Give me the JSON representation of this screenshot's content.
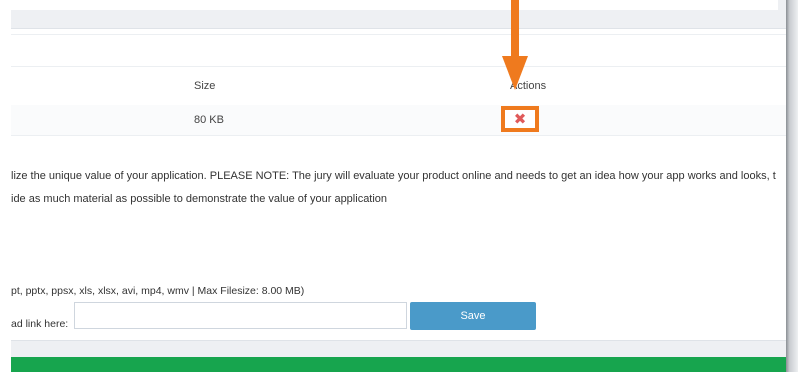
{
  "table": {
    "headers": {
      "size": "Size",
      "actions": "Actions"
    },
    "rows": [
      {
        "size": "80 KB"
      }
    ]
  },
  "description": {
    "line1": "lize the unique value of your application. PLEASE NOTE: The jury will evaluate your product online and needs to get an idea how your app works and looks, t",
    "line2": "ide as much material as possible to demonstrate the value of your application"
  },
  "upload": {
    "file_types": "pt, pptx, ppsx, xls, xlsx, avi, mp4, wmv | Max Filesize: 8.00 MB)",
    "link_label": "ad link here:",
    "link_value": ""
  },
  "buttons": {
    "save_label": "Save",
    "delete_glyph": "✖"
  },
  "annotation": {
    "arrow_color": "#ef7a1e",
    "highlight_color": "#ef7a1e"
  },
  "colors": {
    "save_button": "#4a9ac9",
    "footer_bar": "#17a54e",
    "delete_icon": "#e05a5a"
  }
}
